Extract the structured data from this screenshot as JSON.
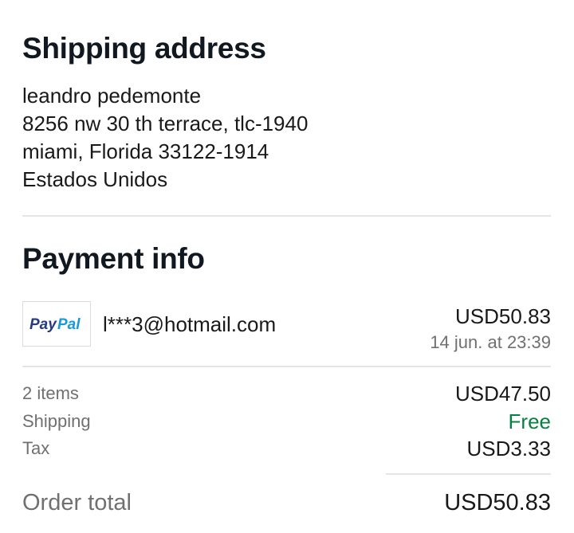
{
  "shipping": {
    "title": "Shipping address",
    "name": "leandro pedemonte",
    "street": "8256 nw 30 th terrace, tlc-1940",
    "city_line": "miami, Florida 33122-1914",
    "country": "Estados Unidos"
  },
  "payment": {
    "title": "Payment info",
    "method": {
      "logo_text": "PayPal",
      "logo_colors": {
        "pay": "#253b80",
        "pal": "#179bd7"
      },
      "email": "l***3@hotmail.com",
      "amount": "USD50.83",
      "date": "14 jun. at 23:39"
    }
  },
  "summary": {
    "rows": [
      {
        "label": "2 items",
        "value": "USD47.50"
      },
      {
        "label": "Shipping",
        "value": "Free"
      },
      {
        "label": "Tax",
        "value": "USD3.33"
      }
    ],
    "total_label": "Order total",
    "total_value": "USD50.83"
  },
  "colors": {
    "text": "#191919",
    "muted": "#707070",
    "free": "#05823f",
    "divider": "#e5e5e5"
  }
}
